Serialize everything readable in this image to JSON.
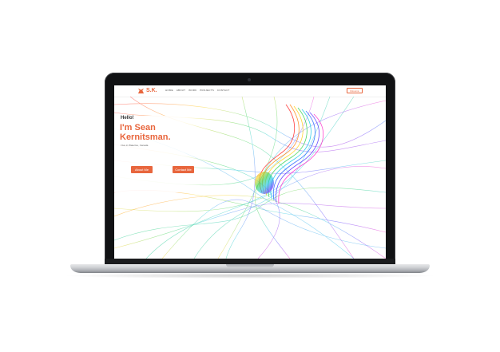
{
  "site": {
    "logo": {
      "text": "S.K.",
      "icon": "fox-icon"
    },
    "nav": [
      "HOME",
      "ABOUT",
      "WORK",
      "PROJECTS",
      "CONTACT"
    ],
    "header_button": "Résumé"
  },
  "hero": {
    "greeting": "Hello!",
    "title": "I'm Sean\nKernitsman.",
    "subtitle": "I live in Waterloo, Canada.",
    "buttons": {
      "about": "About Me",
      "contact": "Contact Me"
    }
  },
  "colors": {
    "accent": "#e8663d",
    "laptop_bezel": "#111214",
    "laptop_base": "#c9cbce"
  }
}
